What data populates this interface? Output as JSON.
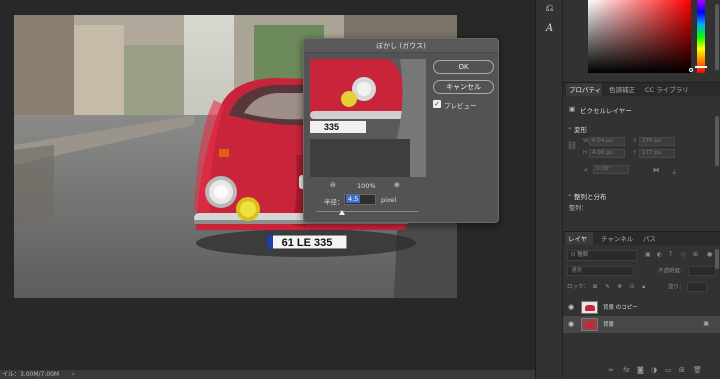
{
  "canvas": {
    "status_text": "イル：3.00M/7.00M",
    "arrow": "›",
    "plate_text": "61 LE 335"
  },
  "toolbar": {
    "icons": [
      "history-brush-icon",
      "type-path-icon"
    ],
    "glyph1": "⎌",
    "glyph2": "A"
  },
  "properties": {
    "tabs": [
      "プロパティ",
      "色調補正",
      "CC ライブラリ"
    ],
    "layer_type": "ピクセルレイヤー",
    "transform_header": "変形",
    "w_label": "W",
    "w_value": "6.04 px",
    "x_label": "X",
    "x_value": "276 px",
    "h_label": "H",
    "h_value": "4.06 px",
    "y_label": "Y",
    "y_value": "177 px",
    "angle": "0.00°",
    "align_header": "整列と分布",
    "align_label": "整列："
  },
  "layers": {
    "tabs": [
      "レイヤー",
      "チャンネル",
      "パス"
    ],
    "search_placeholder": "Q 種類",
    "blend_mode": "通常",
    "opacity_label": "不透明度：",
    "lock_label": "ロック：",
    "fill_label": "塗り：",
    "items": [
      {
        "name": "背景 のコピー"
      },
      {
        "name": "背景",
        "locked": true
      }
    ],
    "bottom_icons": [
      "link-icon",
      "fx-icon",
      "mask-icon",
      "adjustment-icon",
      "group-icon",
      "new-layer-icon",
      "trash-icon"
    ]
  },
  "dialog": {
    "title": "ぼかし (ガウス)",
    "ok_label": "OK",
    "cancel_label": "キャンセル",
    "preview_label": "プレビュー",
    "preview_checked": true,
    "zoom_level": "100%",
    "zoom_out": "⊖",
    "zoom_in": "⊕",
    "radius_label": "半径：",
    "radius_value": "4.5",
    "radius_unit": "pixel",
    "preview_plate": "335"
  },
  "colors": {
    "accent": "#3a6fd1",
    "car_red": "#c8243a",
    "background": "#282828"
  }
}
